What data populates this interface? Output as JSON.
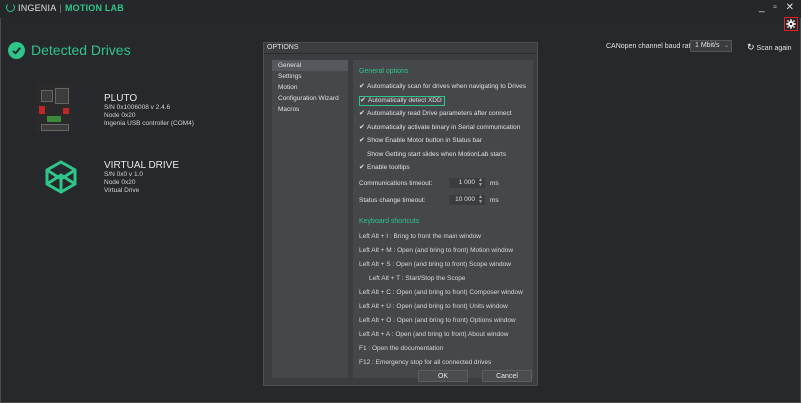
{
  "app": {
    "brand": "INGENIA",
    "separator": "|",
    "product": "MOTION LAB"
  },
  "window": {
    "controls": "_ ▫ ✕"
  },
  "header": {
    "title": "Detected Drives",
    "baud_label": "CANopen channel baud rate:",
    "baud_value": "1 Mbit/s",
    "scan_label": "Scan again"
  },
  "drives": [
    {
      "name": "PLUTO",
      "serial_version": "S/N 0x1006008   v 2.4.6",
      "node": "Node 0x20",
      "connection": "Ingenia USB controller (COM4)"
    },
    {
      "name": "VIRTUAL DRIVE",
      "serial_version": "S/N 0x0   v 1.0",
      "node": "Node 0x20",
      "connection": "Virtual Drive"
    }
  ],
  "options": {
    "title": "OPTIONS",
    "nav": [
      "General",
      "Settings",
      "Motion",
      "Configuration Wizard",
      "Macros"
    ],
    "general_header": "General options",
    "checks": [
      {
        "label": "Automatically scan for drives when navigating to Drives",
        "checked": "✔"
      },
      {
        "label": "Automatically detect XDD",
        "checked": "✔"
      },
      {
        "label": "Automatically read Drive parameters after connect",
        "checked": "✔"
      },
      {
        "label": "Automatically activate binary in Serial communication",
        "checked": "✔"
      },
      {
        "label": "Show Enable Motor button in Status bar",
        "checked": "✔"
      },
      {
        "label": "Show Getting start slides when MotionLab starts",
        "checked": ""
      },
      {
        "label": "Enable tooltips",
        "checked": "✔"
      }
    ],
    "comm_timeout_label": "Communications timeout:",
    "comm_timeout_value": "1 000",
    "status_timeout_label": "Status change timeout:",
    "status_timeout_value": "10 000",
    "unit": "ms",
    "shortcuts_header": "Keyboard shortcuts",
    "shortcuts": [
      "Left Alt + I : Bring to front the main window",
      "Left Alt + M : Open (and bring to front) Motion window",
      "Left Alt + S : Open (and bring to front) Scope window",
      "Left Alt + T : Start/Stop the Scope",
      "Left Alt + C : Open (and bring to front) Composer window",
      "Left Alt + U : Open (and bring to front) Units window",
      "Left Alt + O : Open (and bring to front) Options window",
      "Left Alt + A : Open (and bring to front) About window",
      "F1 : Open the documentation",
      "F12 : Emergency stop for all connected drives"
    ],
    "ok_label": "OK",
    "cancel_label": "Cancel"
  },
  "colors": {
    "accent": "#2fc58a",
    "background": "#26282b",
    "dialog": "#3b3d40",
    "highlight_border": "#e02020"
  }
}
